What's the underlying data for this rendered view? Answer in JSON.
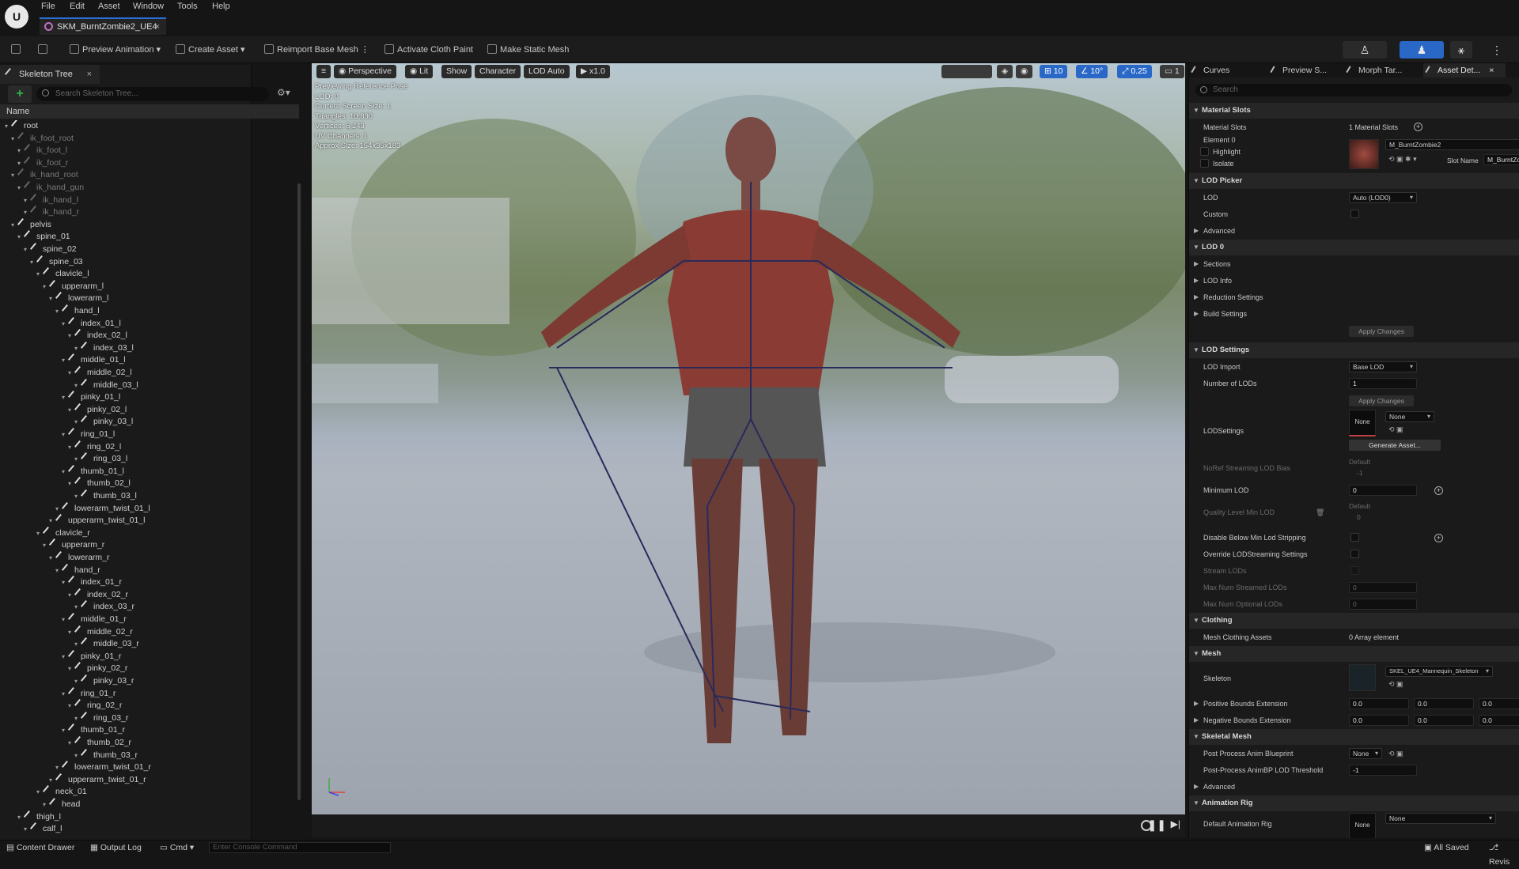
{
  "menu": {
    "logo": "U",
    "items": [
      "File",
      "Edit",
      "Asset",
      "Window",
      "Tools",
      "Help"
    ]
  },
  "asset_tab": {
    "label": "SKM_BurntZombie2_UE4",
    "close": "×"
  },
  "toolbar": {
    "preview_animation": "Preview Animation",
    "create_asset": "Create Asset",
    "reimport": "Reimport Base Mesh",
    "cloth_paint": "Activate Cloth Paint",
    "make_static": "Make Static Mesh"
  },
  "skeleton_tree": {
    "tab_label": "Skeleton Tree",
    "close": "×",
    "add": "+",
    "search_placeholder": "Search Skeleton Tree...",
    "column": "Name",
    "bones": [
      {
        "name": "root",
        "depth": 0,
        "dim": false
      },
      {
        "name": "ik_foot_root",
        "depth": 1,
        "dim": true
      },
      {
        "name": "ik_foot_l",
        "depth": 2,
        "dim": true
      },
      {
        "name": "ik_foot_r",
        "depth": 2,
        "dim": true
      },
      {
        "name": "ik_hand_root",
        "depth": 1,
        "dim": true
      },
      {
        "name": "ik_hand_gun",
        "depth": 2,
        "dim": true
      },
      {
        "name": "ik_hand_l",
        "depth": 3,
        "dim": true
      },
      {
        "name": "ik_hand_r",
        "depth": 3,
        "dim": true
      },
      {
        "name": "pelvis",
        "depth": 1,
        "dim": false
      },
      {
        "name": "spine_01",
        "depth": 2,
        "dim": false
      },
      {
        "name": "spine_02",
        "depth": 3,
        "dim": false
      },
      {
        "name": "spine_03",
        "depth": 4,
        "dim": false
      },
      {
        "name": "clavicle_l",
        "depth": 5,
        "dim": false
      },
      {
        "name": "upperarm_l",
        "depth": 6,
        "dim": false
      },
      {
        "name": "lowerarm_l",
        "depth": 7,
        "dim": false
      },
      {
        "name": "hand_l",
        "depth": 8,
        "dim": false
      },
      {
        "name": "index_01_l",
        "depth": 9,
        "dim": false
      },
      {
        "name": "index_02_l",
        "depth": 10,
        "dim": false
      },
      {
        "name": "index_03_l",
        "depth": 11,
        "dim": false
      },
      {
        "name": "middle_01_l",
        "depth": 9,
        "dim": false
      },
      {
        "name": "middle_02_l",
        "depth": 10,
        "dim": false
      },
      {
        "name": "middle_03_l",
        "depth": 11,
        "dim": false
      },
      {
        "name": "pinky_01_l",
        "depth": 9,
        "dim": false
      },
      {
        "name": "pinky_02_l",
        "depth": 10,
        "dim": false
      },
      {
        "name": "pinky_03_l",
        "depth": 11,
        "dim": false
      },
      {
        "name": "ring_01_l",
        "depth": 9,
        "dim": false
      },
      {
        "name": "ring_02_l",
        "depth": 10,
        "dim": false
      },
      {
        "name": "ring_03_l",
        "depth": 11,
        "dim": false
      },
      {
        "name": "thumb_01_l",
        "depth": 9,
        "dim": false
      },
      {
        "name": "thumb_02_l",
        "depth": 10,
        "dim": false
      },
      {
        "name": "thumb_03_l",
        "depth": 11,
        "dim": false
      },
      {
        "name": "lowerarm_twist_01_l",
        "depth": 8,
        "dim": false
      },
      {
        "name": "upperarm_twist_01_l",
        "depth": 7,
        "dim": false
      },
      {
        "name": "clavicle_r",
        "depth": 5,
        "dim": false
      },
      {
        "name": "upperarm_r",
        "depth": 6,
        "dim": false
      },
      {
        "name": "lowerarm_r",
        "depth": 7,
        "dim": false
      },
      {
        "name": "hand_r",
        "depth": 8,
        "dim": false
      },
      {
        "name": "index_01_r",
        "depth": 9,
        "dim": false
      },
      {
        "name": "index_02_r",
        "depth": 10,
        "dim": false
      },
      {
        "name": "index_03_r",
        "depth": 11,
        "dim": false
      },
      {
        "name": "middle_01_r",
        "depth": 9,
        "dim": false
      },
      {
        "name": "middle_02_r",
        "depth": 10,
        "dim": false
      },
      {
        "name": "middle_03_r",
        "depth": 11,
        "dim": false
      },
      {
        "name": "pinky_01_r",
        "depth": 9,
        "dim": false
      },
      {
        "name": "pinky_02_r",
        "depth": 10,
        "dim": false
      },
      {
        "name": "pinky_03_r",
        "depth": 11,
        "dim": false
      },
      {
        "name": "ring_01_r",
        "depth": 9,
        "dim": false
      },
      {
        "name": "ring_02_r",
        "depth": 10,
        "dim": false
      },
      {
        "name": "ring_03_r",
        "depth": 11,
        "dim": false
      },
      {
        "name": "thumb_01_r",
        "depth": 9,
        "dim": false
      },
      {
        "name": "thumb_02_r",
        "depth": 10,
        "dim": false
      },
      {
        "name": "thumb_03_r",
        "depth": 11,
        "dim": false
      },
      {
        "name": "lowerarm_twist_01_r",
        "depth": 8,
        "dim": false
      },
      {
        "name": "upperarm_twist_01_r",
        "depth": 7,
        "dim": false
      },
      {
        "name": "neck_01",
        "depth": 5,
        "dim": false
      },
      {
        "name": "head",
        "depth": 6,
        "dim": false
      },
      {
        "name": "thigh_l",
        "depth": 2,
        "dim": false
      },
      {
        "name": "calf_l",
        "depth": 3,
        "dim": false
      }
    ]
  },
  "viewport": {
    "perspective": "Perspective",
    "lit": "Lit",
    "show": "Show",
    "character": "Character",
    "lod": "LOD Auto",
    "speed": "x1.0",
    "grid": "10",
    "angle": "10°",
    "scale": "0.25",
    "camera": "1",
    "overlay_lines": [
      "Previewing Reference Pose",
      "LOD: 0",
      "Current Screen Size: 1",
      "Triangles: 10,890",
      "Vertices: 6,243",
      "UV Channels: 1",
      "Approx Size: 154x35x183"
    ]
  },
  "details": {
    "tabs": [
      "Curves",
      "Preview S...",
      "Morph Tar...",
      "Asset Det..."
    ],
    "tab_close": "×",
    "search_placeholder": "Search",
    "material_slots_section": "Material Slots",
    "material_slots_label": "Material Slots",
    "material_slots_value": "1 Material Slots",
    "element0": "Element 0",
    "highlight": "Highlight",
    "isolate": "Isolate",
    "material_name": "M_BurntZombie2",
    "slot_name_label": "Slot Name",
    "slot_name_value": "M_BurntZo",
    "lod_picker_section": "LOD Picker",
    "lod_label": "LOD",
    "lod_value": "Auto (LOD0)",
    "custom": "Custom",
    "advanced": "Advanced",
    "lod0_section": "LOD 0",
    "sections": "Sections",
    "lod_info": "LOD Info",
    "reduction": "Reduction Settings",
    "build": "Build Settings",
    "apply_changes": "Apply Changes",
    "lod_settings_section": "LOD Settings",
    "lod_import": "LOD Import",
    "lod_import_value": "Base LOD",
    "num_lods": "Number of LODs",
    "num_lods_value": "1",
    "lodsettings": "LODSettings",
    "none": "None",
    "generate_asset": "Generate Asset...",
    "noref": "NoRef Streaming LOD Bias",
    "default": "Default",
    "neg_one": "-1",
    "min_lod": "Minimum LOD",
    "zero": "0",
    "quality_min": "Quality Level Min LOD",
    "disable_below": "Disable Below Min Lod Stripping",
    "override_streaming": "Override LODStreaming Settings",
    "stream_lods": "Stream LODs",
    "max_streamed": "Max Num Streamed LODs",
    "max_optional": "Max Num Optional LODs",
    "clothing_section": "Clothing",
    "mesh_clothing": "Mesh Clothing Assets",
    "mesh_clothing_value": "0 Array element",
    "mesh_section": "Mesh",
    "skeleton": "Skeleton",
    "skeleton_value": "SKEL_UE4_Mannequin_Skeleton",
    "pos_bounds": "Positive Bounds Extension",
    "neg_bounds": "Negative Bounds Extension",
    "zero_f": "0.0",
    "skeletal_mesh_section": "Skeletal Mesh",
    "post_process": "Post Process Anim Blueprint",
    "post_process_threshold": "Post-Process AnimBP LOD Threshold",
    "anim_rig_section": "Animation Rig",
    "default_anim_rig": "Default Animation Rig"
  },
  "statusbar": {
    "content_drawer": "Content Drawer",
    "output_log": "Output Log",
    "cmd": "Cmd",
    "console_placeholder": "Enter Console Command",
    "all_saved": "All Saved",
    "revision": "Revis"
  },
  "colors": {
    "accent_blue": "#2a6fd6",
    "add_green": "#2fb24a",
    "mode_active": "#2a68c8"
  }
}
